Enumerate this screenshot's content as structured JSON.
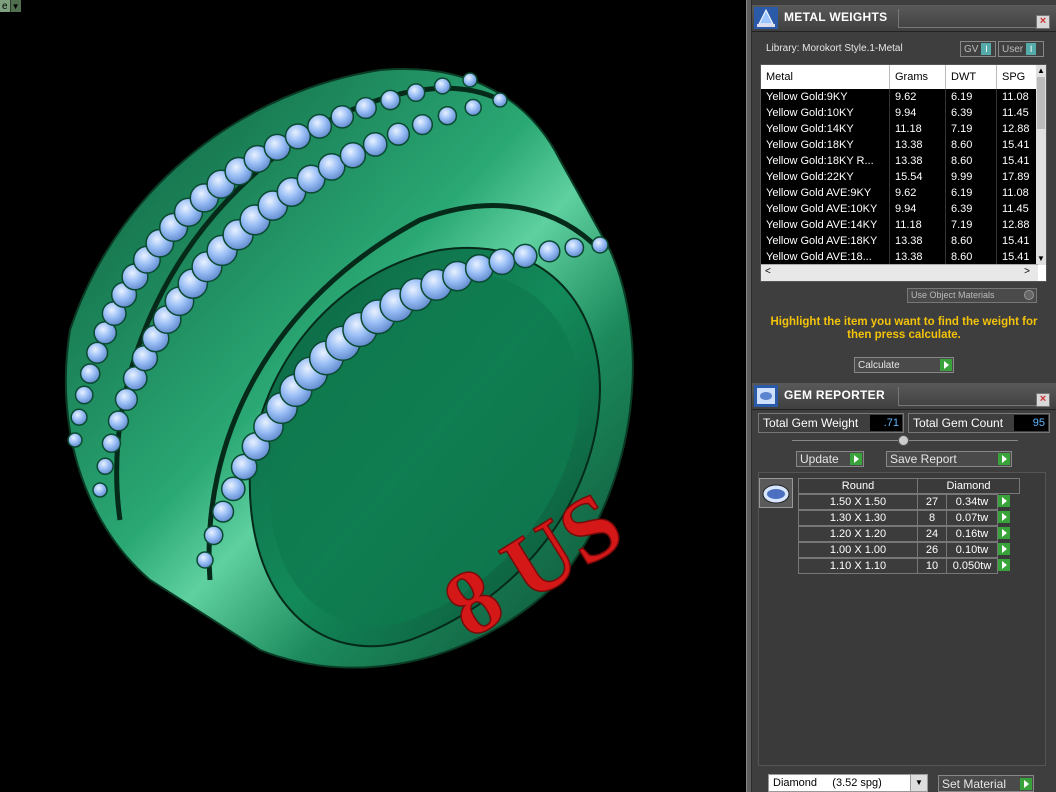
{
  "viewport": {
    "corner_tab_label": "e",
    "ring_size_text": "8 US",
    "colors": {
      "metal": "#1e8a5e",
      "gem": "#8db6f2",
      "text3d": "#d41818"
    }
  },
  "metal_weights": {
    "title": "METAL WEIGHTS",
    "library": "Library: Morokort Style.1-Metal",
    "gv_label": "GV",
    "user_label": "User",
    "columns": [
      "Metal",
      "Grams",
      "DWT",
      "SPG"
    ],
    "rows": [
      [
        "Yellow Gold:9KY",
        "9.62",
        "6.19",
        "11.08"
      ],
      [
        "Yellow Gold:10KY",
        "9.94",
        "6.39",
        "11.45"
      ],
      [
        "Yellow Gold:14KY",
        "11.18",
        "7.19",
        "12.88"
      ],
      [
        "Yellow Gold:18KY",
        "13.38",
        "8.60",
        "15.41"
      ],
      [
        "Yellow Gold:18KY R...",
        "13.38",
        "8.60",
        "15.41"
      ],
      [
        "Yellow Gold:22KY",
        "15.54",
        "9.99",
        "17.89"
      ],
      [
        "Yellow Gold AVE:9KY",
        "9.62",
        "6.19",
        "11.08"
      ],
      [
        "Yellow Gold AVE:10KY",
        "9.94",
        "6.39",
        "11.45"
      ],
      [
        "Yellow Gold AVE:14KY",
        "11.18",
        "7.19",
        "12.88"
      ],
      [
        "Yellow Gold AVE:18KY",
        "13.38",
        "8.60",
        "15.41"
      ],
      [
        "Yellow Gold AVE:18...",
        "13.38",
        "8.60",
        "15.41"
      ]
    ],
    "use_object_materials": "Use Object Materials",
    "hint": "Highlight the item you want to find the weight for then press calculate.",
    "calculate_label": "Calculate"
  },
  "gem_reporter": {
    "title": "GEM REPORTER",
    "total_weight_label": "Total Gem Weight",
    "total_weight_value": ".71",
    "total_count_label": "Total Gem Count",
    "total_count_value": "95",
    "update_label": "Update",
    "save_report_label": "Save Report",
    "table_head": [
      "Round",
      "Diamond"
    ],
    "rows": [
      [
        "1.50 X 1.50",
        "27",
        "0.34tw"
      ],
      [
        "1.30 X 1.30",
        "8",
        "0.07tw"
      ],
      [
        "1.20 X 1.20",
        "24",
        "0.16tw"
      ],
      [
        "1.00 X 1.00",
        "26",
        "0.10tw"
      ],
      [
        "1.10 X 1.10",
        "10",
        "0.050tw"
      ]
    ],
    "material_select": "Diamond     (3.52 spg)",
    "set_material_label": "Set Material"
  }
}
